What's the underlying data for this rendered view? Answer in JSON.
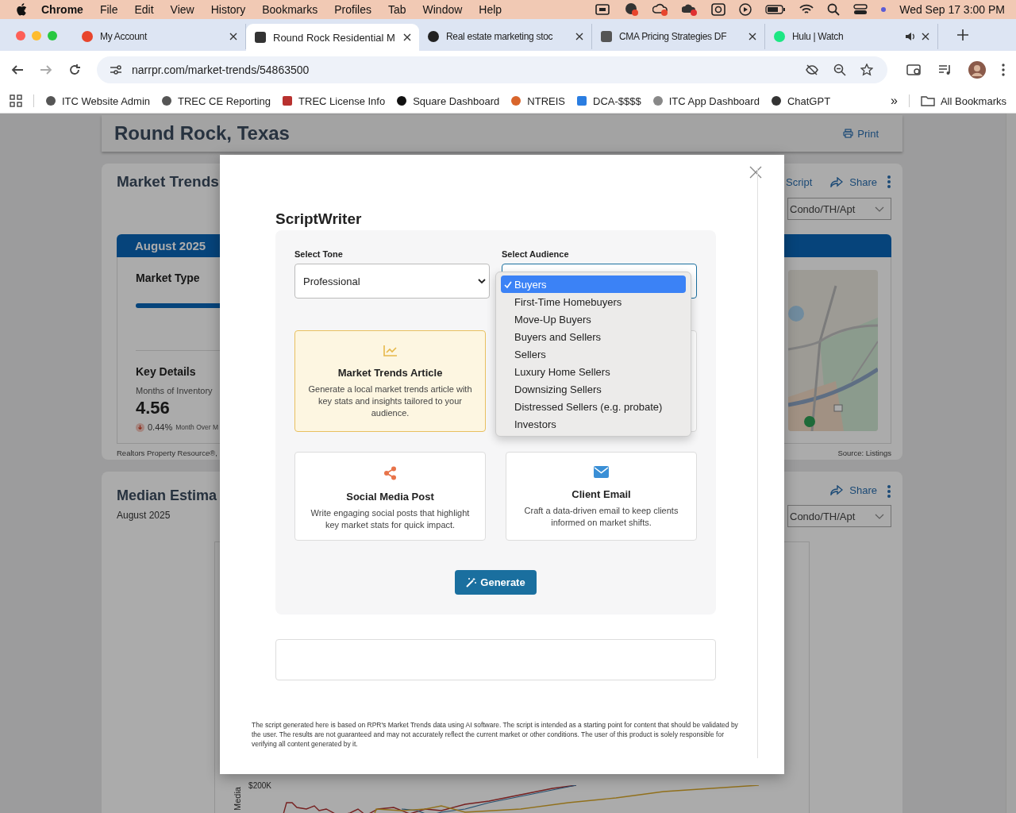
{
  "menu_bar": {
    "app": "Chrome",
    "menus": [
      "File",
      "Edit",
      "View",
      "History",
      "Bookmarks",
      "Profiles",
      "Tab",
      "Window",
      "Help"
    ],
    "clock": "Wed Sep 17 3:00 PM"
  },
  "tabs": [
    {
      "title": "My Account",
      "selected": false
    },
    {
      "title": "Round Rock Residential M",
      "selected": true
    },
    {
      "title": "Real estate marketing stoc",
      "selected": false
    },
    {
      "title": "CMA Pricing Strategies DF",
      "selected": false
    },
    {
      "title": "Hulu | Watch",
      "selected": false
    }
  ],
  "address_bar": {
    "url": "narrpr.com/market-trends/54863500"
  },
  "bookmarks": [
    "ITC Website Admin",
    "TREC CE Reporting",
    "TREC License Info",
    "Square Dashboard",
    "NTREIS",
    "DCA-$$$$",
    "ITC App Dashboard",
    "ChatGPT"
  ],
  "more_bookmarks": "»",
  "all_bookmarks": "All Bookmarks",
  "page": {
    "location_title": "Round Rock, Texas",
    "print": "Print",
    "market_trends": {
      "title": "Market Trends",
      "script": "Script",
      "share": "Share",
      "property_type": "Condo/TH/Apt",
      "period": "August 2025",
      "market_type": "Market Type",
      "key_details": "Key Details",
      "metric_label": "Months of Inventory",
      "metric_value": "4.56",
      "change": "0.44%",
      "change_label": "Month Over M",
      "attribution": "Realtors Property Resource®,",
      "source": "Source: Listings"
    },
    "median_estimate": {
      "title": "Median Estima",
      "period": "August 2025",
      "share": "Share",
      "property_type": "Condo/TH/Apt",
      "y_tick": "$200K",
      "y_label": "Media"
    }
  },
  "modal": {
    "title": "ScriptWriter",
    "tone": {
      "label": "Select Tone",
      "value": "Professional"
    },
    "audience": {
      "label": "Select Audience",
      "options": [
        {
          "label": "Buyers",
          "selected": true
        },
        {
          "label": "First-Time Homebuyers",
          "selected": false
        },
        {
          "label": "Move-Up Buyers",
          "selected": false
        },
        {
          "label": "Buyers and Sellers",
          "selected": false
        },
        {
          "label": "Sellers",
          "selected": false
        },
        {
          "label": "Luxury Home Sellers",
          "selected": false
        },
        {
          "label": "Downsizing Sellers",
          "selected": false
        },
        {
          "label": "Distressed Sellers (e.g. probate)",
          "selected": false
        },
        {
          "label": "Investors",
          "selected": false
        }
      ]
    },
    "script_types": [
      {
        "kind": "chart",
        "title": "Market Trends Article",
        "description": "Generate a local market trends article with key stats and insights tailored to your audience.",
        "selected": true
      },
      {
        "kind": "share",
        "title": "Social Media Post",
        "description": "Write engaging social posts that highlight key market stats for quick impact.",
        "selected": false
      },
      {
        "kind": "email",
        "title": "Client Email",
        "description": "Craft a data-driven email to keep clients informed on market shifts.",
        "selected": false
      }
    ],
    "generate": "Generate",
    "disclaimer": "The script generated here is based on RPR's Market Trends data using AI software. The script is intended as a starting point for content that should be validated by the user. The results are not guaranteed and may not accurately reflect the current market or other conditions. The user of this product is solely responsible for verifying all content generated by it."
  }
}
